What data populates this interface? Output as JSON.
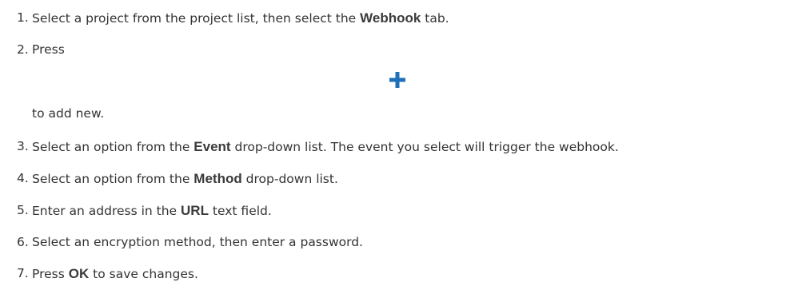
{
  "steps": [
    {
      "number": "1.",
      "before": "Select a project from the project list, then select the ",
      "ui": "Webhook",
      "after": " tab."
    },
    {
      "number": "2.",
      "before": "Press",
      "icon": "plus-icon",
      "continuation": "to add new."
    },
    {
      "number": "3.",
      "before": "Select an option from the ",
      "ui": "Event",
      "after": " drop-down list. The event you select will trigger the webhook."
    },
    {
      "number": "4.",
      "before": "Select an option from the ",
      "ui": "Method",
      "after": " drop-down list."
    },
    {
      "number": "5.",
      "before": "Enter an address in the ",
      "ui": "URL",
      "after": " text field."
    },
    {
      "number": "6.",
      "before": "Select an encryption method, then enter a password."
    },
    {
      "number": "7.",
      "before": "Press ",
      "ui": "OK",
      "after": " to save changes."
    }
  ],
  "colors": {
    "text": "#333333",
    "plus_icon": "#1f6fb8"
  }
}
